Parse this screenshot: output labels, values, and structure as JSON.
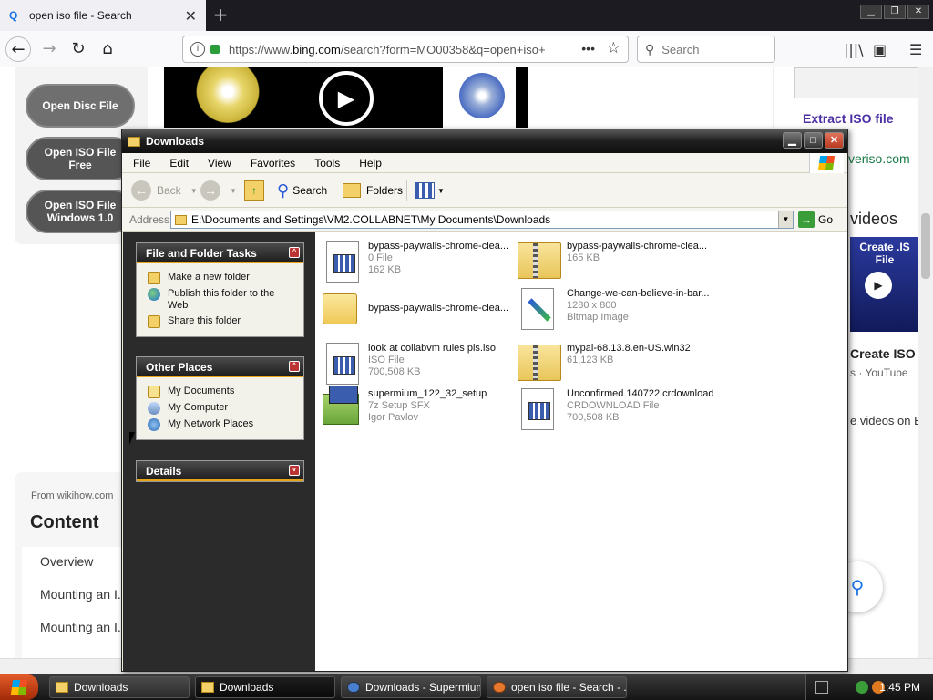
{
  "browser": {
    "tab_title": "open iso file - Search",
    "url": "https://www.bing.com/search?form=MO00358&q=open+iso+",
    "url_prefix": "https://www.",
    "url_domain": "bing.com",
    "url_rest": "/search?form=MO00358&q=open+iso+",
    "search_placeholder": "Search"
  },
  "page": {
    "left_buttons": [
      {
        "line1": "Open Disc File",
        "line2": ""
      },
      {
        "line1": "Open ISO File",
        "line2": "Free"
      },
      {
        "line1": "Open ISO File",
        "line2": "Windows 1.0"
      }
    ],
    "extract_label": "Extract ISO file",
    "veriso_text": "veriso.com",
    "videos_heading": "videos",
    "video_thumb_text": "Create .IS File",
    "video_title": "Create ISO I",
    "video_source": "s · YouTube",
    "more_videos": "e videos on E",
    "from_source": "From wikihow.com",
    "content_title": "Content",
    "content_items": [
      "Overview",
      "Mounting an I...",
      "Mounting an I..."
    ]
  },
  "explorer": {
    "title": "Downloads",
    "menu": [
      "File",
      "Edit",
      "View",
      "Favorites",
      "Tools",
      "Help"
    ],
    "toolbar": {
      "back": "Back",
      "search": "Search",
      "folders": "Folders"
    },
    "address_label": "Address",
    "address_path": "E:\\Documents and Settings\\VM2.COLLABNET\\My Documents\\Downloads",
    "go_label": "Go",
    "panels": {
      "file_tasks": {
        "title": "File and Folder Tasks",
        "items": [
          "Make a new folder",
          "Publish this folder to the Web",
          "Share this folder"
        ]
      },
      "other_places": {
        "title": "Other Places",
        "items": [
          "My Documents",
          "My Computer",
          "My Network Places"
        ]
      },
      "details": {
        "title": "Details"
      }
    },
    "files": [
      {
        "name": "bypass-paywalls-chrome-clea...",
        "line2": "0 File",
        "line3": "162 KB",
        "icon": "generic-file"
      },
      {
        "name": "bypass-paywalls-chrome-clea...",
        "line2": "165 KB",
        "line3": "",
        "icon": "zip-folder"
      },
      {
        "name": "bypass-paywalls-chrome-clea...",
        "line2": "",
        "line3": "",
        "icon": "folder"
      },
      {
        "name": "Change-we-can-believe-in-bar...",
        "line2": "1280 x 800",
        "line3": "Bitmap Image",
        "icon": "bitmap"
      },
      {
        "name": "look at collabvm rules pls.iso",
        "line2": "ISO File",
        "line3": "700,508 KB",
        "icon": "generic-file"
      },
      {
        "name": "mypal-68.13.8.en-US.win32",
        "line2": "61,123 KB",
        "line3": "",
        "icon": "zip-folder"
      },
      {
        "name": "supermium_122_32_setup",
        "line2": "7z Setup SFX",
        "line3": "Igor Pavlov",
        "icon": "setup"
      },
      {
        "name": "Unconfirmed 140722.crdownload",
        "line2": "CRDOWNLOAD File",
        "line3": "700,508 KB",
        "icon": "generic-file"
      }
    ]
  },
  "taskbar": {
    "buttons": [
      "Downloads",
      "Downloads",
      "Downloads - Supermium",
      "open iso file - Search - ..."
    ],
    "clock": "1:45 PM"
  }
}
